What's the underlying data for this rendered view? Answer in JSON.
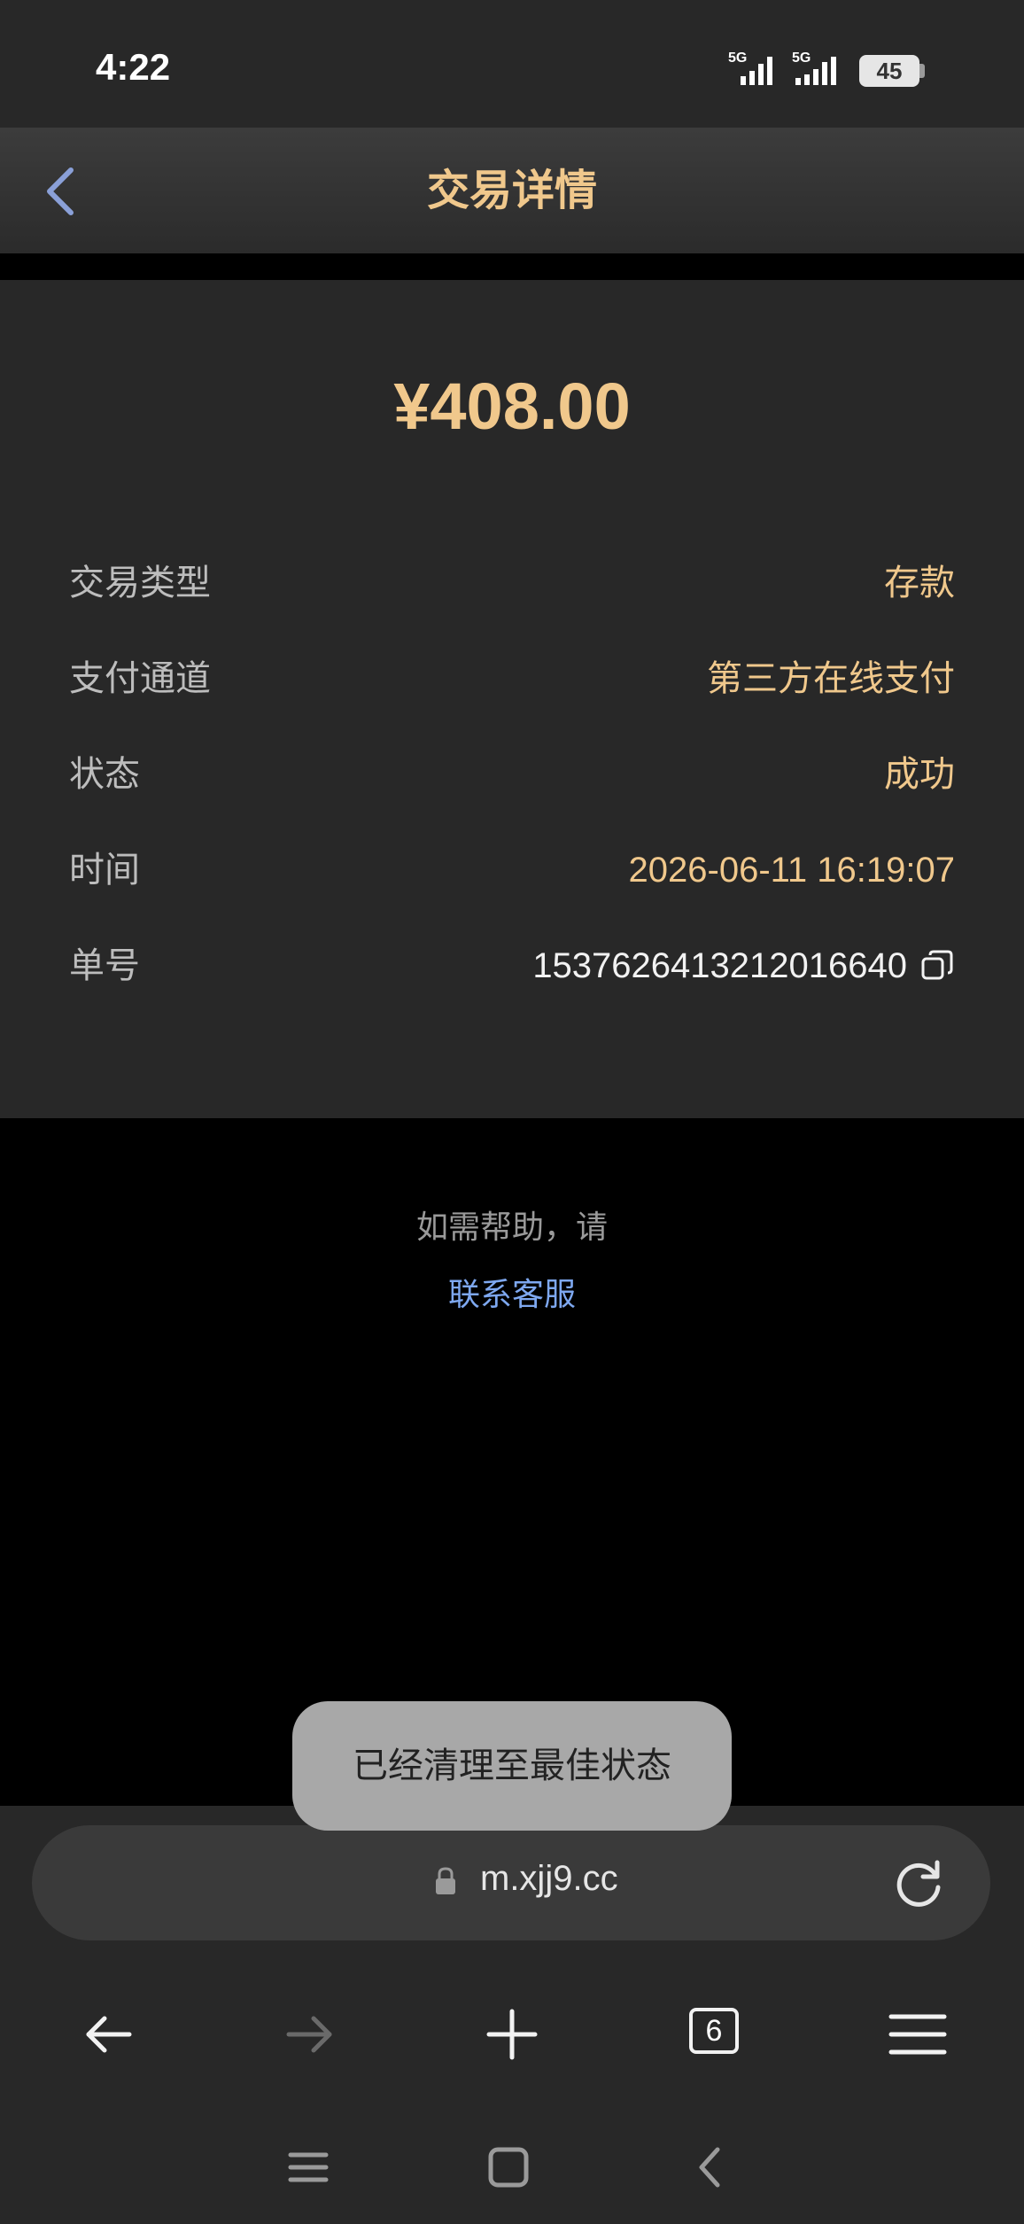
{
  "status_bar": {
    "time": "4:22",
    "network_1": "5G",
    "network_2": "5G",
    "battery": "45"
  },
  "header": {
    "title": "交易详情"
  },
  "transaction": {
    "amount": "¥408.00",
    "rows": [
      {
        "label": "交易类型",
        "value": "存款"
      },
      {
        "label": "支付通道",
        "value": "第三方在线支付"
      },
      {
        "label": "状态",
        "value": "成功"
      },
      {
        "label": "时间",
        "value": "2026-06-11 16:19:07"
      },
      {
        "label": "单号",
        "value": "1537626413212016640"
      }
    ]
  },
  "help": {
    "text": "如需帮助，请",
    "link": "联系客服"
  },
  "toast": {
    "message": "已经清理至最佳状态"
  },
  "browser": {
    "url": "m.xjj9.cc",
    "tab_count": "6"
  },
  "colors": {
    "accent_gold": "#f0c88c",
    "link_blue": "#7ea8f0",
    "panel": "#282828"
  }
}
